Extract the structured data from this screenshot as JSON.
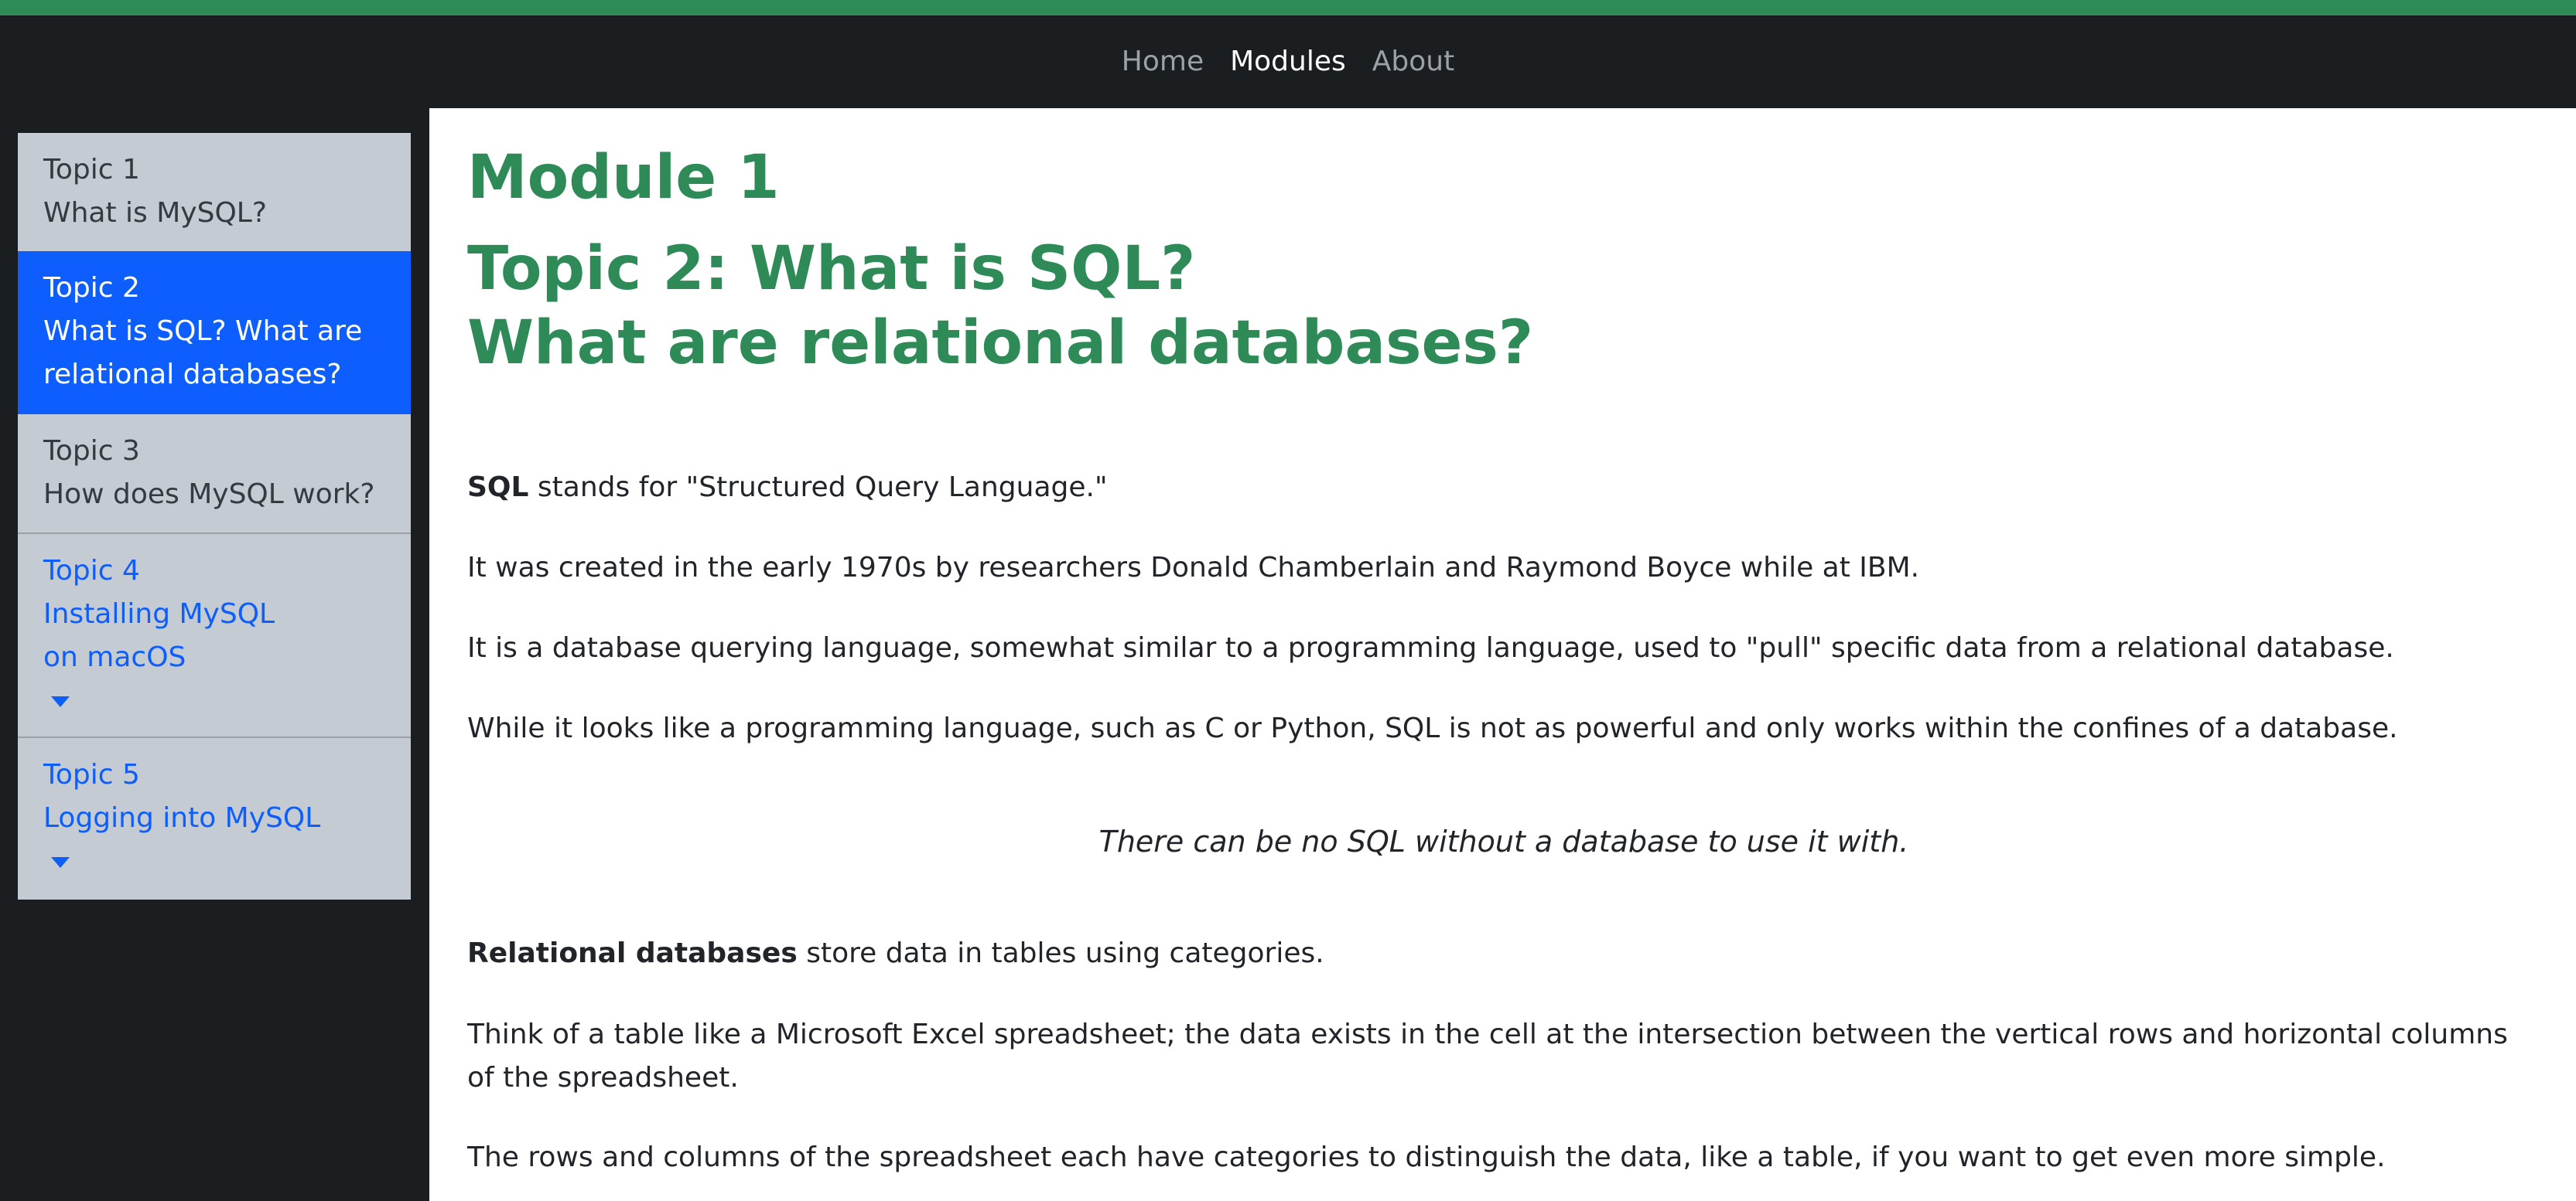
{
  "nav": {
    "items": [
      {
        "label": "Home",
        "active": false
      },
      {
        "label": "Modules",
        "active": true
      },
      {
        "label": "About",
        "active": false
      }
    ]
  },
  "sidebar": {
    "items": [
      {
        "topic": "Topic 1",
        "subtitle": "What is MySQL?",
        "state": "default"
      },
      {
        "topic": "Topic 2",
        "subtitle": "What is SQL? What are relational databases?",
        "state": "active"
      },
      {
        "topic": "Topic 3",
        "subtitle": "How does MySQL work?",
        "state": "default"
      },
      {
        "topic": "Topic 4",
        "subtitle": "Installing MySQL on macOS",
        "state": "link",
        "expandable": true
      },
      {
        "topic": "Topic 5",
        "subtitle": "Logging into MySQL",
        "state": "link",
        "expandable": true
      }
    ]
  },
  "main": {
    "module_title": "Module 1",
    "topic_title_line1": "Topic 2: What is SQL?",
    "topic_title_line2": "What are relational databases?",
    "p1_bold": "SQL",
    "p1_rest": " stands for \"Structured Query Language.\"",
    "p2": "It was created in the early 1970s by researchers Donald Chamberlain and Raymond Boyce while at IBM.",
    "p3": "It is a database querying language, somewhat similar to a programming language, used to \"pull\" specific data from a relational database.",
    "p4": "While it looks like a programming language, such as C or Python, SQL is not as powerful and only works within the confines of a database.",
    "quote": "There can be no SQL without a database to use it with.",
    "p5_bold": "Relational databases",
    "p5_rest": " store data in tables using categories.",
    "p6": "Think of a table like a Microsoft Excel spreadsheet; the data exists in the cell at the intersection between the vertical rows and horizontal columns of the spreadsheet.",
    "p7": "The rows and columns of the spreadsheet each have categories to distinguish the data, like a table, if you want to get even more simple."
  },
  "colors": {
    "accent": "#2e8b57",
    "active_blue": "#0d5efd",
    "sidebar_bg": "#c5cbd3",
    "page_bg": "#1a1e21"
  }
}
